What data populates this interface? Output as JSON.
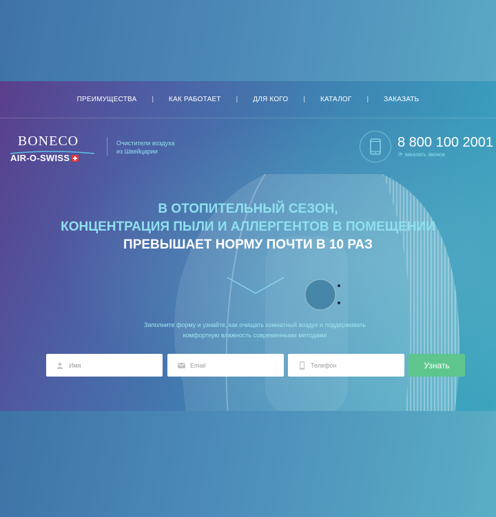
{
  "nav": {
    "items": [
      {
        "label": "ПРЕИМУЩЕСТВА"
      },
      {
        "label": "КАК РАБОТАЕТ"
      },
      {
        "label": "ДЛЯ КОГО"
      },
      {
        "label": "КАТАЛОГ"
      },
      {
        "label": "ЗАКАЗАТЬ"
      }
    ],
    "separator": "|"
  },
  "brand": {
    "logo_top": "BONECO",
    "logo_bottom": "AIR-O-SWISS",
    "tagline_line1": "Очистители воздуха",
    "tagline_line2": "из Швейцарии"
  },
  "contact": {
    "phone": "8 800 100 2001",
    "callback_label": "заказать звонок",
    "phone_icon": "smartphone-icon",
    "callback_icon": "refresh-icon"
  },
  "hero": {
    "headline_line1": "В ОТОПИТЕЛЬНЫЙ СЕЗОН,",
    "headline_line2": "КОНЦЕНТРАЦИЯ ПЫЛИ И АЛЛЕРГЕНТОВ В ПОМЕЩЕНИИ",
    "headline_line3": "ПРЕВЫШАЕТ НОРМУ ПОЧТИ В 10 РАЗ",
    "subtext_line1": "Заполните форму и узнайте, как очищать комнатный воздух и поддерживать",
    "subtext_line2": "комфортную влажность современными методами"
  },
  "form": {
    "name_placeholder": "Имя",
    "email_placeholder": "Email",
    "phone_placeholder": "Телефон",
    "submit_label": "Узнать",
    "name_icon": "user-icon",
    "email_icon": "envelope-icon",
    "phone_icon": "mobile-icon"
  },
  "colors": {
    "accent_cyan": "#8fe0ee",
    "submit_green": "#5ec68d",
    "swiss_red": "#e03a3a"
  }
}
